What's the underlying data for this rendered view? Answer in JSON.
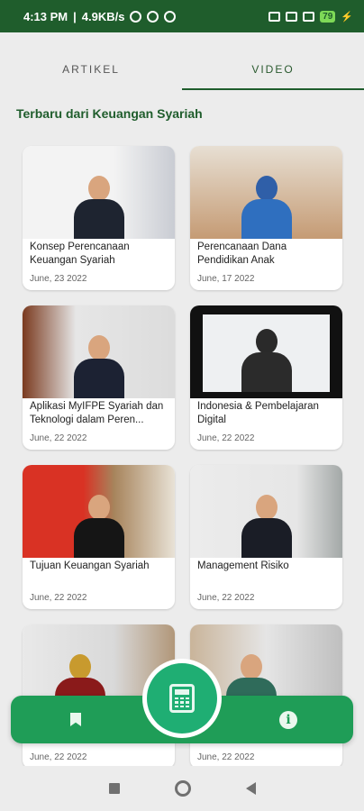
{
  "status_bar": {
    "time": "4:13 PM",
    "network_speed": "4.9KB/s",
    "battery": "79"
  },
  "tabs": [
    {
      "label": "ARTIKEL",
      "active": false
    },
    {
      "label": "VIDEO",
      "active": true
    }
  ],
  "section_title": "Terbaru dari Keuangan Syariah",
  "videos": [
    {
      "title": "Konsep Perencanaan Keuangan Syariah",
      "date": "June, 23 2022"
    },
    {
      "title": "Perencanaan Dana Pendidikan Anak",
      "date": "June, 17 2022"
    },
    {
      "title": "Aplikasi MyIFPE Syariah dan Teknologi dalam Peren...",
      "date": "June, 22 2022"
    },
    {
      "title": "Indonesia & Pembelajaran Digital",
      "date": "June, 22 2022"
    },
    {
      "title": "Tujuan Keuangan Syariah",
      "date": "June, 22 2022"
    },
    {
      "title": "Management Risiko",
      "date": "June, 22 2022"
    },
    {
      "title": "",
      "date": "June, 22 2022"
    },
    {
      "title": "",
      "date": "June, 22 2022"
    }
  ],
  "bottom_nav": {
    "left_icon": "bookmark-icon",
    "center_icon": "calculator-icon",
    "right_icon": "info-icon"
  },
  "colors": {
    "primary_dark": "#1f5d2c",
    "nav_green": "#1f9d57",
    "fab_green": "#1fae73"
  }
}
